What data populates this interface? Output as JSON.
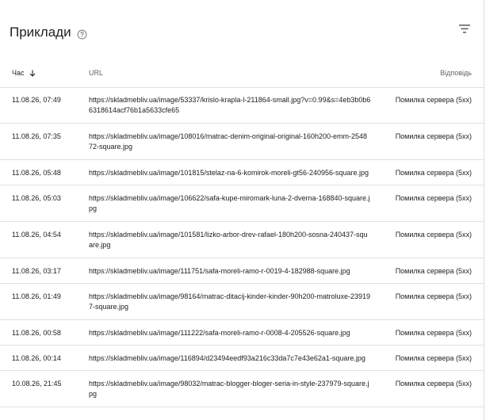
{
  "header": {
    "title": "Приклади",
    "help_icon": "help-circle-icon",
    "filter_icon": "filter-icon"
  },
  "table": {
    "columns": {
      "time": "Час",
      "url": "URL",
      "response": "Відповідь"
    },
    "sort_icon": "arrow-down-icon",
    "rows": [
      {
        "time": "11.08.26, 07:49",
        "url": "https://skladmebliv.ua/image/53337/krislo-krapla-l-211864-small.jpg?v=0.99&s=4eb3b0b66318614acf76b1a5633cfe65",
        "response": "Помилка сервера (5xx)"
      },
      {
        "time": "11.08.26, 07:35",
        "url": "https://skladmebliv.ua/image/108016/matrac-denim-original-original-160h200-emm-254872-square.jpg",
        "response": "Помилка сервера (5xx)"
      },
      {
        "time": "11.08.26, 05:48",
        "url": "https://skladmebliv.ua/image/101815/stelaz-na-6-komirok-moreli-gt56-240956-square.jpg",
        "response": "Помилка сервера (5xx)"
      },
      {
        "time": "11.08.26, 05:03",
        "url": "https://skladmebliv.ua/image/106622/safa-kupe-miromark-luna-2-dverna-168840-square.jpg",
        "response": "Помилка сервера (5xx)"
      },
      {
        "time": "11.08.26, 04:54",
        "url": "https://skladmebliv.ua/image/101581/lizko-arbor-drev-rafael-180h200-sosna-240437-square.jpg",
        "response": "Помилка сервера (5xx)"
      },
      {
        "time": "11.08.26, 03:17",
        "url": "https://skladmebliv.ua/image/111751/safa-moreli-ramo-r-0019-4-182988-square.jpg",
        "response": "Помилка сервера (5xx)"
      },
      {
        "time": "11.08.26, 01:49",
        "url": "https://skladmebliv.ua/image/98164/matrac-ditacij-kinder-kinder-90h200-matroluxe-239197-square.jpg",
        "response": "Помилка сервера (5xx)"
      },
      {
        "time": "11.08.26, 00:58",
        "url": "https://skladmebliv.ua/image/111222/safa-moreli-ramo-r-0008-4-205526-square.jpg",
        "response": "Помилка сервера (5xx)"
      },
      {
        "time": "11.08.26, 00:14",
        "url": "https://skladmebliv.ua/image/116894/d23494eedf93a216c33da7c7e43e62a1-square.jpg",
        "response": "Помилка сервера (5xx)"
      },
      {
        "time": "10.08.26, 21:45",
        "url": "https://skladmebliv.ua/image/98032/matrac-blogger-bloger-seria-in-style-237979-square.jpg",
        "response": "Помилка сервера (5xx)"
      }
    ]
  }
}
